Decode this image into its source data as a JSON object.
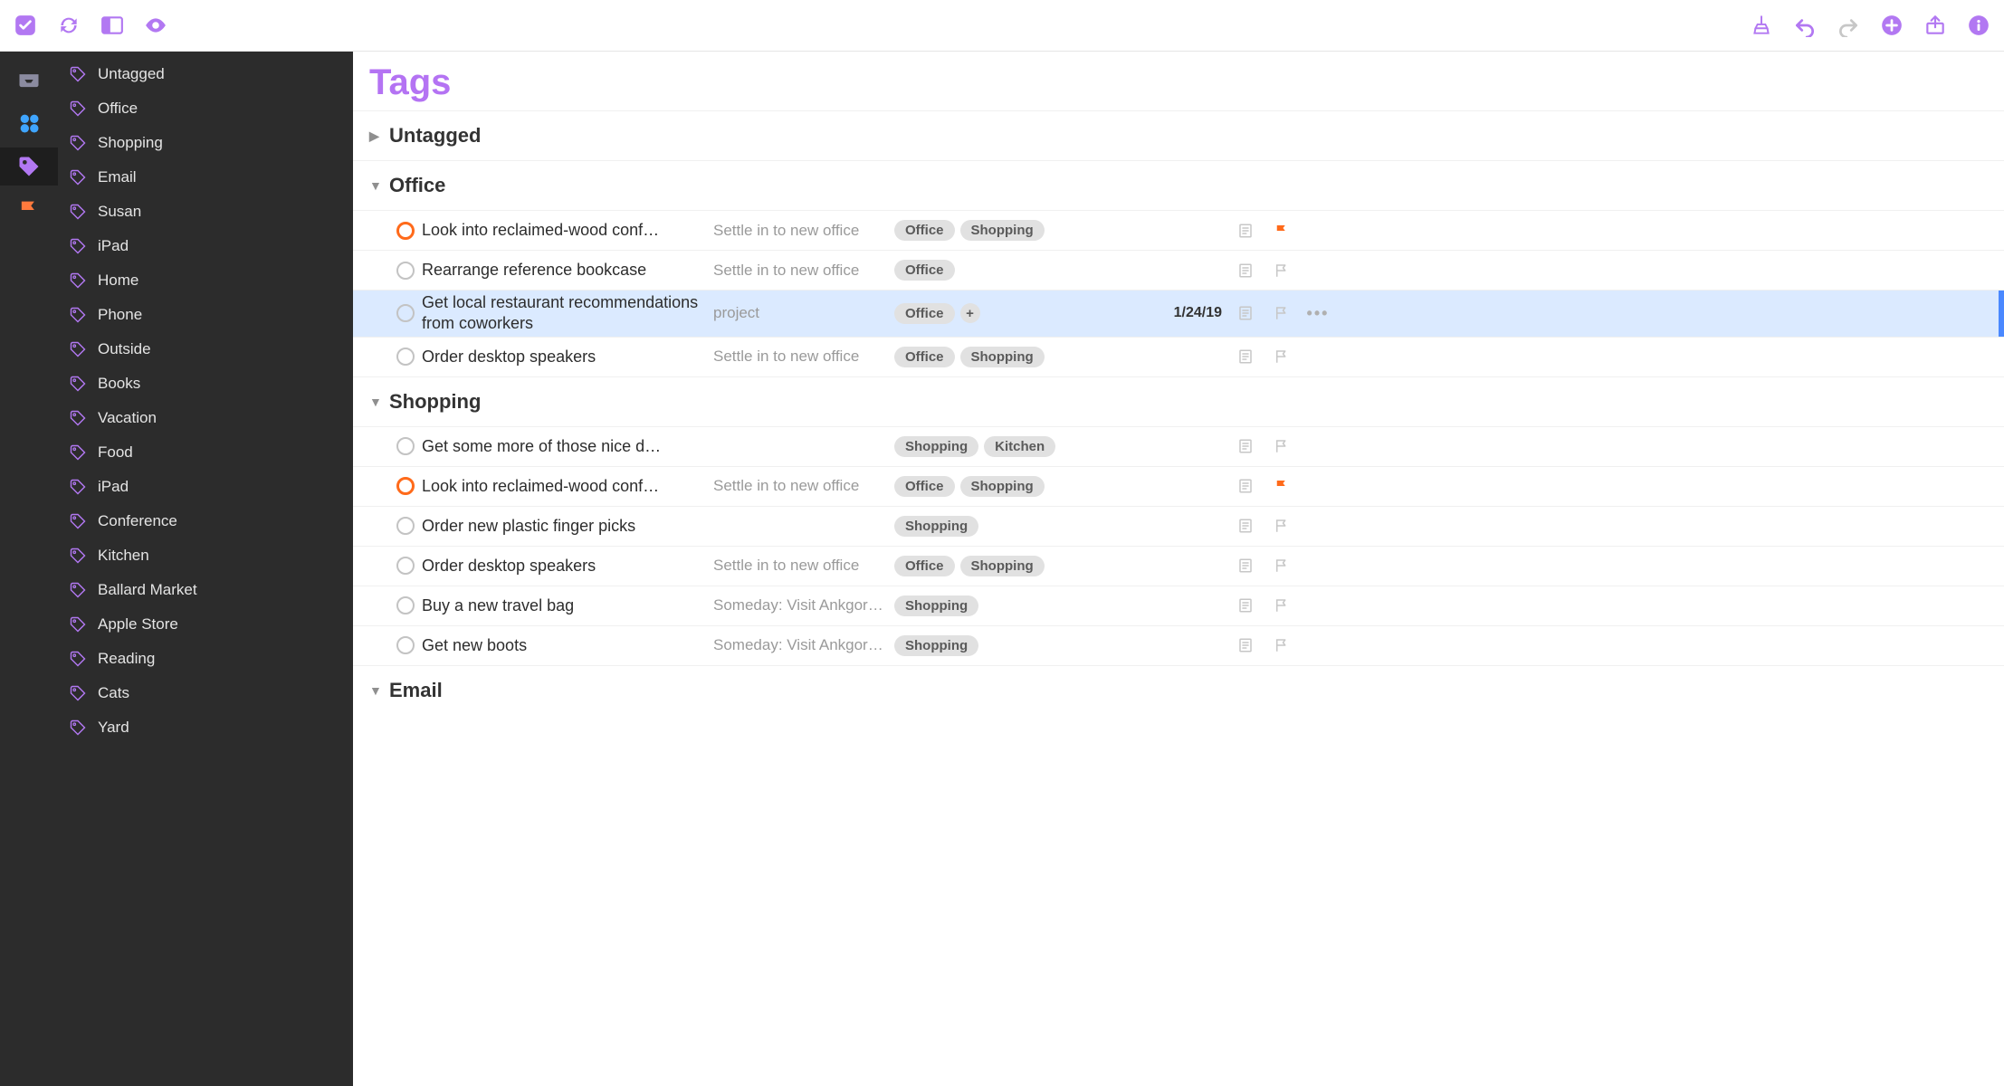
{
  "page_title": "Tags",
  "rail": [
    {
      "name": "inbox",
      "icon": "tray",
      "color": "grey"
    },
    {
      "name": "projects",
      "icon": "dots",
      "color": "blue"
    },
    {
      "name": "tags",
      "icon": "tag",
      "color": "purple",
      "active": true
    },
    {
      "name": "flagged",
      "icon": "flag",
      "color": "orange"
    }
  ],
  "sidebar_tags": [
    "Untagged",
    "Office",
    "Shopping",
    "Email",
    "Susan",
    "iPad",
    "Home",
    "Phone",
    "Outside",
    "Books",
    "Vacation",
    "Food",
    "iPad",
    "Conference",
    "Kitchen",
    "Ballard Market",
    "Apple Store",
    "Reading",
    "Cats",
    "Yard"
  ],
  "groups": [
    {
      "name": "Untagged",
      "expanded": false,
      "tasks": []
    },
    {
      "name": "Office",
      "expanded": true,
      "tasks": [
        {
          "title": "Look into reclaimed-wood conf…",
          "project": "Settle in to new office",
          "tags": [
            "Office",
            "Shopping"
          ],
          "flagged": true,
          "circle": "orange"
        },
        {
          "title": "Rearrange reference bookcase",
          "project": "Settle in to new office",
          "tags": [
            "Office"
          ],
          "flagged": false
        },
        {
          "title": "Get local restaurant recommen­dations from coworkers",
          "project": "project",
          "tags": [
            "Office"
          ],
          "tag_plus": true,
          "due": "1/24/19",
          "flagged": false,
          "selected": true,
          "wrap": true
        },
        {
          "title": "Order desktop speakers",
          "project": "Settle in to new office",
          "tags": [
            "Office",
            "Shopping"
          ],
          "flagged": false
        }
      ]
    },
    {
      "name": "Shopping",
      "expanded": true,
      "tasks": [
        {
          "title": "Get some more of those nice d…",
          "project": "",
          "tags": [
            "Shopping",
            "Kitchen"
          ],
          "flagged": false
        },
        {
          "title": "Look into reclaimed-wood conf…",
          "project": "Settle in to new office",
          "tags": [
            "Office",
            "Shopping"
          ],
          "flagged": true,
          "circle": "orange"
        },
        {
          "title": "Order new plastic finger picks",
          "project": "",
          "tags": [
            "Shopping"
          ],
          "flagged": false
        },
        {
          "title": "Order desktop speakers",
          "project": "Settle in to new office",
          "tags": [
            "Office",
            "Shopping"
          ],
          "flagged": false
        },
        {
          "title": "Buy a new travel bag",
          "project": "Someday: Visit Ankgor …",
          "tags": [
            "Shopping"
          ],
          "flagged": false
        },
        {
          "title": "Get new boots",
          "project": "Someday: Visit Ankgor …",
          "tags": [
            "Shopping"
          ],
          "flagged": false
        }
      ]
    },
    {
      "name": "Email",
      "expanded": true,
      "tasks": []
    }
  ]
}
